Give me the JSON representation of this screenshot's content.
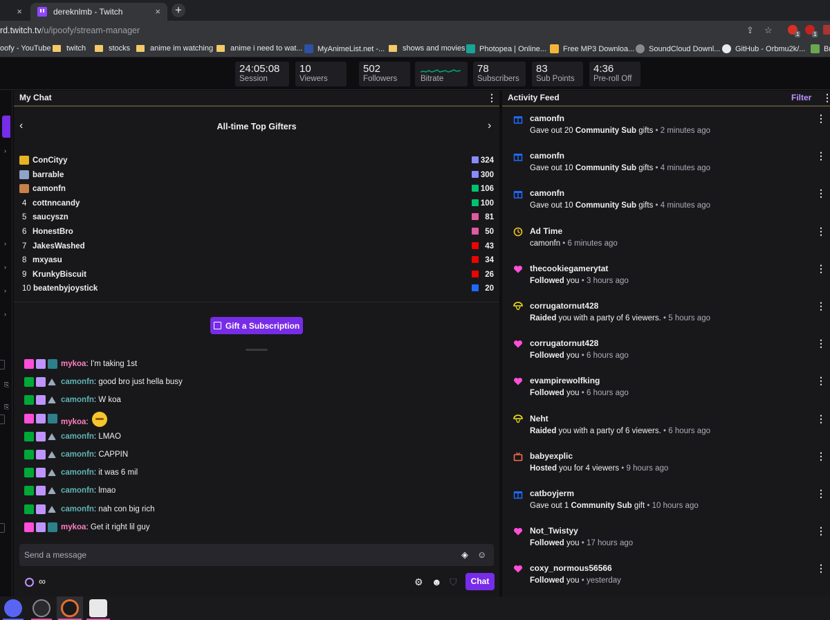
{
  "browser": {
    "prev_tab_close": "×",
    "active_tab_title": "dereknlmb - Twitch",
    "active_tab_close": "×",
    "new_tab": "+",
    "url_host": "rd.twitch.tv",
    "url_path": "/u/ipoofy/stream-manager",
    "bookmarks": [
      "oofy - YouTube",
      "twitch",
      "stocks",
      "anime im watching",
      "anime i need to wat...",
      "MyAnimeList.net -...",
      "shows and movies",
      "Photopea | Online...",
      "Free MP3 Downloa...",
      "SoundCloud Downl...",
      "GitHub - Orbmu2k/...",
      "Br"
    ],
    "ext_badges": [
      "1",
      "1"
    ]
  },
  "stats": [
    {
      "value": "24:05:08",
      "label": "Session"
    },
    {
      "value": "10",
      "label": "Viewers"
    },
    {
      "value": "502",
      "label": "Followers"
    },
    {
      "value": "",
      "label": "Bitrate"
    },
    {
      "value": "78",
      "label": "Subscribers"
    },
    {
      "value": "83",
      "label": "Sub Points"
    },
    {
      "value": "4:36",
      "label": "Pre-roll Off"
    }
  ],
  "chat": {
    "title": "My Chat",
    "gifters_title": "All-time Top Gifters",
    "gifters": [
      {
        "rank": "",
        "name": "ConCityy",
        "count": "324",
        "color": "#8a8aff"
      },
      {
        "rank": "",
        "name": "barrable",
        "count": "300",
        "color": "#8a8aff"
      },
      {
        "rank": "",
        "name": "camonfn",
        "count": "106",
        "color": "#00c16f"
      },
      {
        "rank": "4",
        "name": "cottnncandy",
        "count": "100",
        "color": "#00c16f"
      },
      {
        "rank": "5",
        "name": "saucyszn",
        "count": "81",
        "color": "#e05aa2"
      },
      {
        "rank": "6",
        "name": "HonestBro",
        "count": "50",
        "color": "#e05aa2"
      },
      {
        "rank": "7",
        "name": "JakesWashed",
        "count": "43",
        "color": "#eb0400"
      },
      {
        "rank": "8",
        "name": "mxyasu",
        "count": "34",
        "color": "#eb0400"
      },
      {
        "rank": "9",
        "name": "KrunkyBiscuit",
        "count": "26",
        "color": "#eb0400"
      },
      {
        "rank": "10",
        "name": "beatenbyjoystick",
        "count": "20",
        "color": "#1f69ff"
      }
    ],
    "gift_button": "Gift a Subscription",
    "messages": [
      {
        "user": "mykoa",
        "text": "I'm taking 1st",
        "color": "#ff7fbf"
      },
      {
        "user": "camonfn",
        "text": "good bro just hella busy",
        "color": "#5fb3b3"
      },
      {
        "user": "camonfn",
        "text": "W koa",
        "color": "#5fb3b3"
      },
      {
        "user": "mykoa",
        "text": "",
        "color": "#ff7fbf"
      },
      {
        "user": "camonfn",
        "text": "LMAO",
        "color": "#5fb3b3"
      },
      {
        "user": "camonfn",
        "text": "CAPPIN",
        "color": "#5fb3b3"
      },
      {
        "user": "camonfn",
        "text": "it was 6 mil",
        "color": "#5fb3b3"
      },
      {
        "user": "camonfn",
        "text": "lmao",
        "color": "#5fb3b3"
      },
      {
        "user": "camonfn",
        "text": "nah con big rich",
        "color": "#5fb3b3"
      },
      {
        "user": "mykoa",
        "text": "Get it right lil guy",
        "color": "#ff7fbf"
      }
    ],
    "input_placeholder": "Send a message",
    "points_value": "∞",
    "chat_button": "Chat"
  },
  "feed": {
    "title": "Activity Feed",
    "filter": "Filter",
    "items": [
      {
        "icon": "gift-icon",
        "name": "camonfn",
        "pre": "Gave out 20 ",
        "strong": "Community Sub",
        "post": " gifts",
        "time": " • 2 minutes ago",
        "color": "#1f69ff"
      },
      {
        "icon": "gift-icon",
        "name": "camonfn",
        "pre": "Gave out 10 ",
        "strong": "Community Sub",
        "post": " gifts",
        "time": " • 4 minutes ago",
        "color": "#1f69ff"
      },
      {
        "icon": "gift-icon",
        "name": "camonfn",
        "pre": "Gave out 10 ",
        "strong": "Community Sub",
        "post": " gifts",
        "time": " • 4 minutes ago",
        "color": "#1f69ff"
      },
      {
        "icon": "clock-icon",
        "name": "Ad Time",
        "pre": "",
        "strong": "",
        "post": "camonfn",
        "time": " • 6 minutes ago",
        "color": "#f5c518"
      },
      {
        "icon": "heart-icon",
        "name": "thecookiegamerytat",
        "pre": "",
        "strong": "Followed",
        "post": " you",
        "time": " • 3 hours ago",
        "color": "#ff4fd8"
      },
      {
        "icon": "raid-icon",
        "name": "corrugatornut428",
        "pre": "",
        "strong": "Raided",
        "post": " you with a party of 6 viewers.",
        "time": " • 5 hours ago",
        "color": "#f5e218"
      },
      {
        "icon": "heart-icon",
        "name": "corrugatornut428",
        "pre": "",
        "strong": "Followed",
        "post": " you",
        "time": " • 6 hours ago",
        "color": "#ff4fd8"
      },
      {
        "icon": "heart-icon",
        "name": "evampirewolfking",
        "pre": "",
        "strong": "Followed",
        "post": " you",
        "time": " • 6 hours ago",
        "color": "#ff4fd8"
      },
      {
        "icon": "raid-icon",
        "name": "Neht",
        "pre": "",
        "strong": "Raided",
        "post": " you with a party of 6 viewers.",
        "time": " • 6 hours ago",
        "color": "#f5e218"
      },
      {
        "icon": "tv-icon",
        "name": "babyexplic",
        "pre": "",
        "strong": "Hosted",
        "post": " you for 4 viewers",
        "time": " • 9 hours ago",
        "color": "#ff6b4a"
      },
      {
        "icon": "gift-icon",
        "name": "catboyjerm",
        "pre": "Gave out 1 ",
        "strong": "Community Sub",
        "post": " gift",
        "time": " • 10 hours ago",
        "color": "#1f69ff"
      },
      {
        "icon": "heart-icon",
        "name": "Not_Twistyy",
        "pre": "",
        "strong": "Followed",
        "post": " you",
        "time": " • 17 hours ago",
        "color": "#ff4fd8"
      },
      {
        "icon": "heart-icon",
        "name": "coxy_normous56566",
        "pre": "",
        "strong": "Followed",
        "post": " you",
        "time": " • yesterday",
        "color": "#ff4fd8"
      }
    ]
  }
}
